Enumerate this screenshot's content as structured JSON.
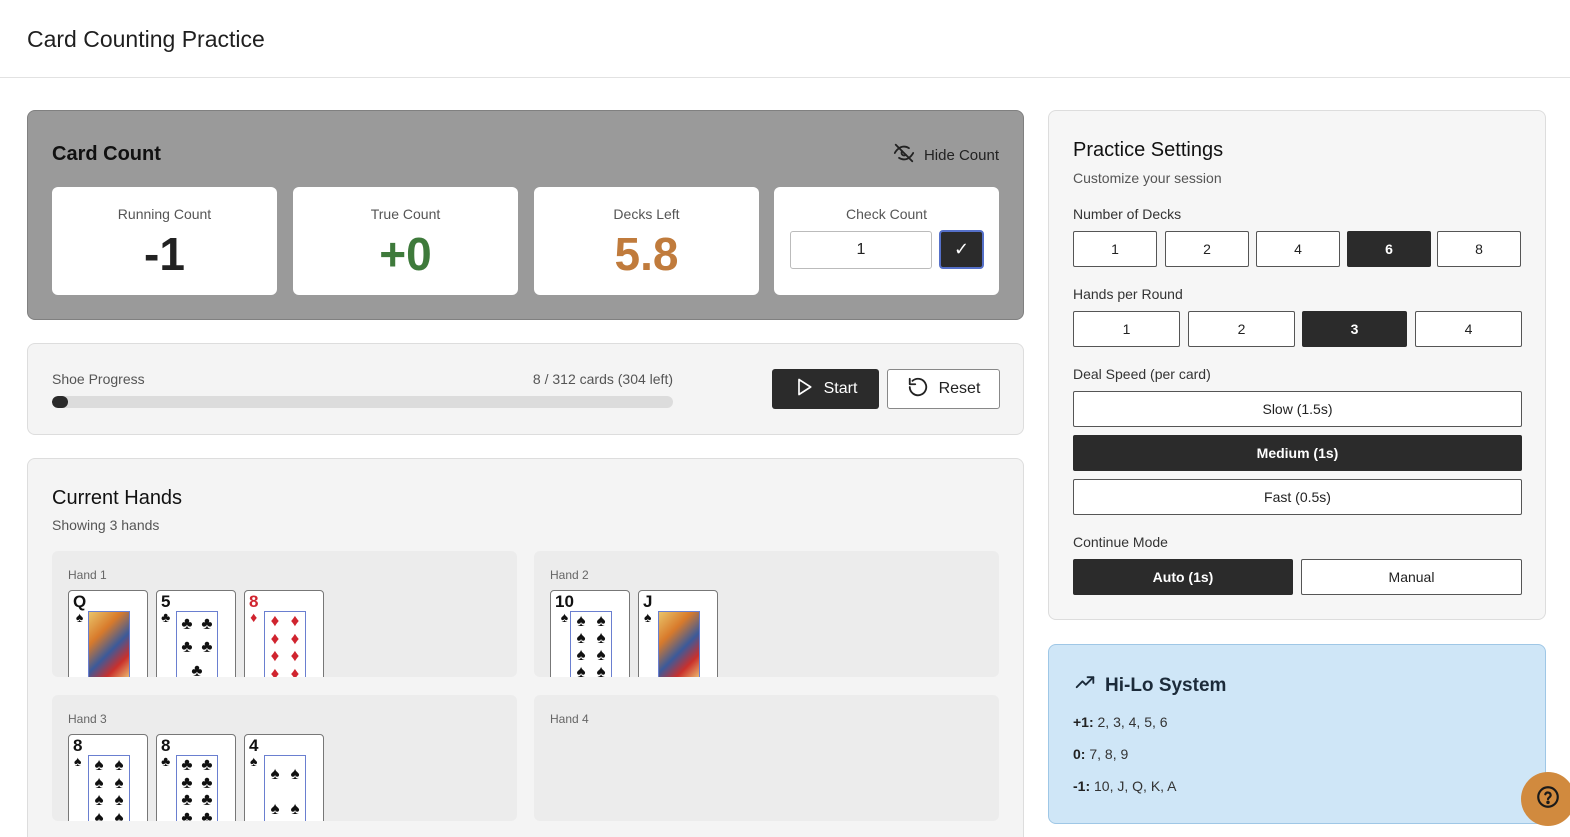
{
  "app": {
    "title": "Card Counting Practice"
  },
  "count_panel": {
    "title": "Card Count",
    "hide_label": "Hide Count",
    "running": {
      "label": "Running Count",
      "value": "-1"
    },
    "true_count": {
      "label": "True Count",
      "value": "+0"
    },
    "decks_left": {
      "label": "Decks Left",
      "value": "5.8"
    },
    "check": {
      "label": "Check Count",
      "input_value": "1",
      "submit_glyph": "✓"
    },
    "colors": {
      "panel_bg": "#9a9a9a",
      "true_count": "#3e7a3b",
      "decks_left": "#c07b3c"
    }
  },
  "shoe": {
    "label": "Shoe Progress",
    "stats": "8 / 312 cards (304 left)",
    "progress_fraction": 0.0256,
    "start_label": "Start",
    "reset_label": "Reset"
  },
  "hands": {
    "title": "Current Hands",
    "subtitle": "Showing 3 hands",
    "slots": [
      {
        "label": "Hand 1",
        "cards": [
          {
            "rank": "Q",
            "suit": "♠",
            "color": "black",
            "face": true
          },
          {
            "rank": "5",
            "suit": "♣",
            "color": "black"
          },
          {
            "rank": "8",
            "suit": "♦",
            "color": "red"
          }
        ]
      },
      {
        "label": "Hand 2",
        "cards": [
          {
            "rank": "10",
            "suit": "♠",
            "color": "black"
          },
          {
            "rank": "J",
            "suit": "♠",
            "color": "black",
            "face": true
          }
        ]
      },
      {
        "label": "Hand 3",
        "cards": [
          {
            "rank": "8",
            "suit": "♠",
            "color": "black"
          },
          {
            "rank": "8",
            "suit": "♣",
            "color": "black"
          },
          {
            "rank": "4",
            "suit": "♠",
            "color": "black"
          }
        ]
      },
      {
        "label": "Hand 4",
        "cards": []
      }
    ]
  },
  "settings": {
    "title": "Practice Settings",
    "subtitle": "Customize your session",
    "decks": {
      "label": "Number of Decks",
      "options": [
        "1",
        "2",
        "4",
        "6",
        "8"
      ],
      "selected": "6"
    },
    "hands_per_round": {
      "label": "Hands per Round",
      "options": [
        "1",
        "2",
        "3",
        "4"
      ],
      "selected": "3"
    },
    "deal_speed": {
      "label": "Deal Speed (per card)",
      "options": [
        "Slow (1.5s)",
        "Medium (1s)",
        "Fast (0.5s)"
      ],
      "selected": "Medium (1s)"
    },
    "continue_mode": {
      "label": "Continue Mode",
      "options": [
        "Auto (1s)",
        "Manual"
      ],
      "selected": "Auto (1s)"
    }
  },
  "hilo": {
    "title": "Hi-Lo System",
    "rows": [
      {
        "key": "+1:",
        "values": "2, 3, 4, 5, 6"
      },
      {
        "key": "0:",
        "values": "7, 8, 9"
      },
      {
        "key": "-1:",
        "values": "10, J, Q, K, A"
      }
    ]
  },
  "icons": {
    "hide": "eye-off-icon",
    "start": "play-icon",
    "reset": "rotate-ccw-icon",
    "hilo": "trending-up-icon",
    "help": "help-circle-icon"
  }
}
